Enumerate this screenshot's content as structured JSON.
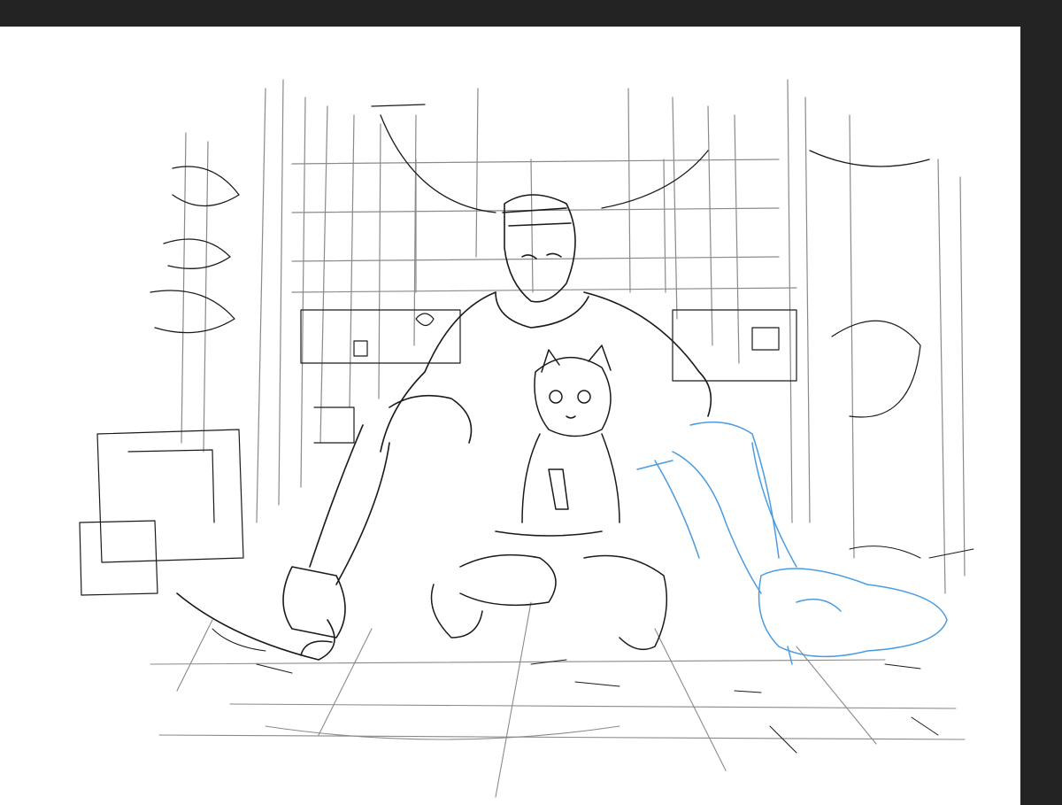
{
  "app": {
    "background_color": "#232323",
    "canvas_color": "#ffffff"
  },
  "artwork": {
    "ink_color": "#1a1a1a",
    "sketch_layer_color": "#4a9be0"
  }
}
